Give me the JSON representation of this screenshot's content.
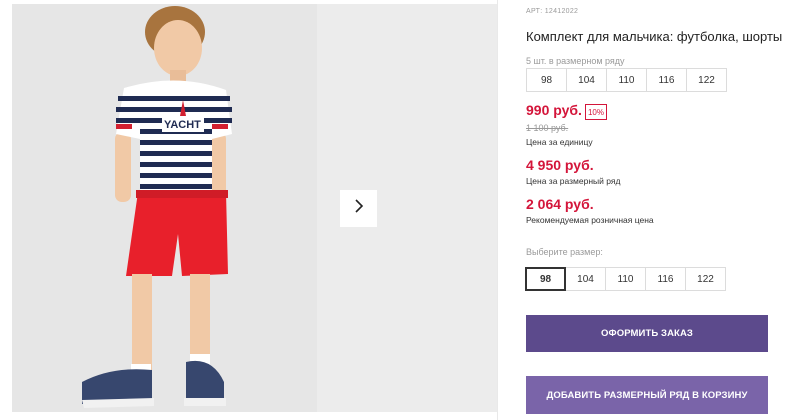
{
  "gallery": {
    "next_icon": "chevron-right-icon",
    "colors": {
      "shirt_stripe": "#1f2b52",
      "shorts": "#e8202b",
      "background": "#e6e6e6"
    }
  },
  "product": {
    "article": "АРТ: 12412022",
    "title": "Комплект для мальчика: футболка, шорты",
    "row_caption": "5 шт. в размерном ряду",
    "row_sizes": [
      "98",
      "104",
      "110",
      "116",
      "122"
    ],
    "price": "990 руб.",
    "discount": "10%",
    "old_price": "1 100 руб.",
    "unit_caption": "Цена за единицу",
    "row_price": "4 950 руб.",
    "row_price_caption": "Цена за размерный ряд",
    "retail_price": "2 064 руб.",
    "retail_caption": "Рекомендуемая розничная цена",
    "choose_size_label": "Выберите размер:",
    "size_options": [
      "98",
      "104",
      "110",
      "116",
      "122"
    ],
    "selected_size": "98"
  },
  "buttons": {
    "order": "ОФОРМИТЬ ЗАКАЗ",
    "add_row_to_cart": "ДОБАВИТЬ РАЗМЕРНЫЙ РЯД В КОРЗИНУ"
  },
  "colors": {
    "accent_price": "#d4153a",
    "primary_button": "#5c4a8c",
    "secondary_button": "#7a64a9"
  }
}
